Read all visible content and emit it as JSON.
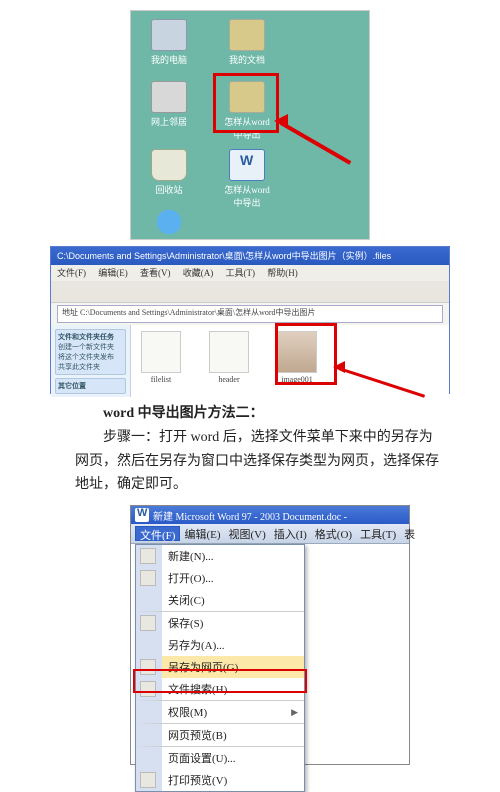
{
  "fig1": {
    "icons": {
      "computer": "我的电脑",
      "docs": "我的文档",
      "net": "网上邻居",
      "folder": "怎样从word中导出",
      "bin": "回收站",
      "word": "怎样从word中导出"
    }
  },
  "fig2": {
    "title": "C:\\Documents and Settings\\Administrator\\桌面\\怎样从word中导出图片（实例）.files",
    "menu": {
      "file": "文件(F)",
      "edit": "编辑(E)",
      "view": "查看(V)",
      "fav": "收藏(A)",
      "tools": "工具(T)",
      "help": "帮助(H)"
    },
    "path": "地址 C:\\Documents and Settings\\Administrator\\桌面\\怎样从word中导出图片",
    "side": {
      "sec1": "文件和文件夹任务",
      "s1a": "创建一个新文件夹",
      "s1b": "将这个文件夹发布",
      "s1c": "共享此文件夹",
      "sec2": "其它位置"
    },
    "items": {
      "a": "filelist",
      "b": "header",
      "c": "image001"
    }
  },
  "text": {
    "heading": "word 中导出图片方法二：",
    "para": "步骤一：打开 word 后，选择文件菜单下来中的另存为网页，然后在另存为窗口中选择保存类型为网页，选择保存地址，确定即可。"
  },
  "fig3": {
    "title": "新建 Microsoft Word 97 - 2003 Document.doc -",
    "menu": {
      "file": "文件(F)",
      "edit": "编辑(E)",
      "view": "视图(V)",
      "insert": "插入(I)",
      "format": "格式(O)",
      "tools": "工具(T)",
      "table": "表"
    },
    "items": {
      "new": "新建(N)...",
      "open": "打开(O)...",
      "close": "关闭(C)",
      "save": "保存(S)",
      "saveas": "另存为(A)...",
      "saveweb": "另存为网页(G)...",
      "search": "文件搜索(H)...",
      "perm": "权限(M)",
      "webprev": "网页预览(B)",
      "pagesetup": "页面设置(U)...",
      "printprev": "打印预览(V)"
    }
  }
}
